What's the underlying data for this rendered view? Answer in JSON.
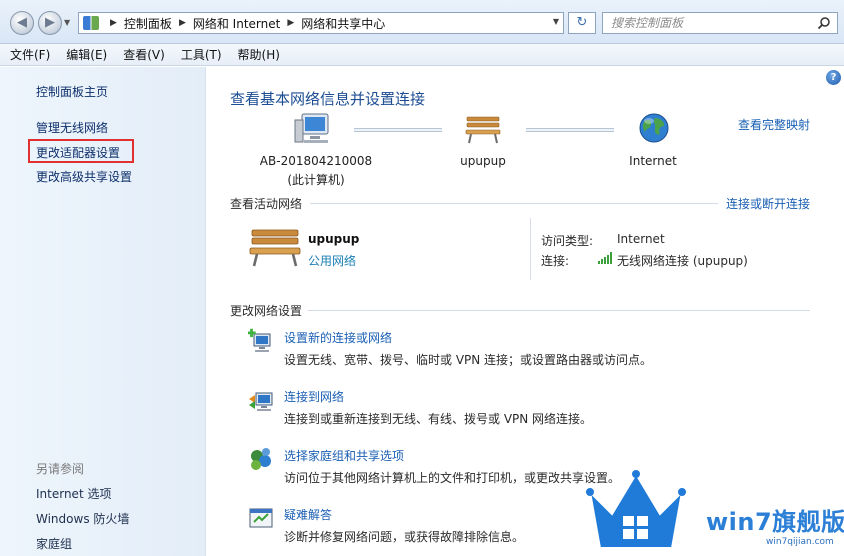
{
  "address": {
    "breadcrumb": [
      "控制面板",
      "网络和 Internet",
      "网络和共享中心"
    ],
    "search_placeholder": "搜索控制面板"
  },
  "menu": [
    "文件(F)",
    "编辑(E)",
    "查看(V)",
    "工具(T)",
    "帮助(H)"
  ],
  "sidebar": {
    "items": [
      "控制面板主页",
      "管理无线网络",
      "更改适配器设置",
      "更改高级共享设置"
    ],
    "see_also_label": "另请参阅",
    "see_also": [
      "Internet 选项",
      "Windows 防火墙",
      "家庭组"
    ]
  },
  "main": {
    "title": "查看基本网络信息并设置连接",
    "full_map": "查看完整映射",
    "map": {
      "computer_name": "AB-201804210008",
      "computer_sub": "(此计算机)",
      "network_name": "upupup",
      "internet": "Internet"
    },
    "active": {
      "heading": "查看活动网络",
      "connect_link": "连接或断开连接",
      "name": "upupup",
      "type": "公用网络",
      "access_label": "访问类型:",
      "access_value": "Internet",
      "conn_label": "连接:",
      "conn_value": "无线网络连接 (upupup)"
    },
    "change": {
      "heading": "更改网络设置",
      "tasks": [
        {
          "link": "设置新的连接或网络",
          "desc": "设置无线、宽带、拨号、临时或 VPN 连接；或设置路由器或访问点。",
          "icon": "network-setup-icon"
        },
        {
          "link": "连接到网络",
          "desc": "连接到或重新连接到无线、有线、拨号或 VPN 网络连接。",
          "icon": "connect-network-icon"
        },
        {
          "link": "选择家庭组和共享选项",
          "desc": "访问位于其他网络计算机上的文件和打印机，或更改共享设置。",
          "icon": "homegroup-icon"
        },
        {
          "link": "疑难解答",
          "desc": "诊断并修复网络问题，或获得故障排除信息。",
          "icon": "troubleshoot-icon"
        }
      ]
    }
  },
  "watermark": {
    "brand": "win7旗舰版",
    "url": "win7qijian.com"
  },
  "colors": {
    "link": "#1a5fb4",
    "highlight_box": "#e23030",
    "sidebar_bg": "#e8f1fa"
  }
}
